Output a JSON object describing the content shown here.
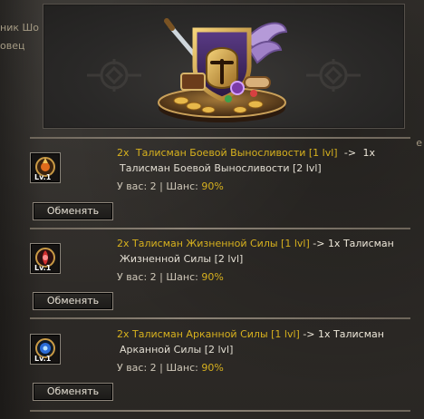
{
  "side_text": {
    "line1": "ник Шо",
    "line2": "овец",
    "right_mark": "е"
  },
  "banner": {
    "emblem_icon": "knight-helmet-shield-icon"
  },
  "offers": [
    {
      "give_qty": "2x",
      "give_item": "Талисман Боевой Выносливости [1 lvl]",
      "arrow": "->",
      "get_qty": "1x",
      "get_item": "Талисман Боевой Выносливости [2 lvl]",
      "have_label": "У вас: 2 | Шанс:",
      "chance": "90%",
      "button_label": "Обменять",
      "icon": "orange-talisman-icon",
      "level_badge": "Lv.1"
    },
    {
      "give_qty": "2x",
      "give_item": "Талисман Жизненной Силы [1 lvl]",
      "arrow": "->",
      "get_qty": "1x Талисман",
      "get_item": "Жизненной Силы [2 lvl]",
      "have_label": "У вас: 2 | Шанс:",
      "chance": "90%",
      "button_label": "Обменять",
      "icon": "red-talisman-icon",
      "level_badge": "Lv.1"
    },
    {
      "give_qty": "2x",
      "give_item": "Талисман Арканной Силы [1 lvl]",
      "arrow": "->",
      "get_qty": "1x Талисман",
      "get_item": "Арканной Силы [2 lvl]",
      "have_label": "У вас: 2 | Шанс:",
      "chance": "90%",
      "button_label": "Обменять",
      "icon": "blue-talisman-icon",
      "level_badge": "Lv.1"
    }
  ],
  "colors": {
    "accent_gold": "#d7b11e",
    "background": "#2f2c28"
  }
}
